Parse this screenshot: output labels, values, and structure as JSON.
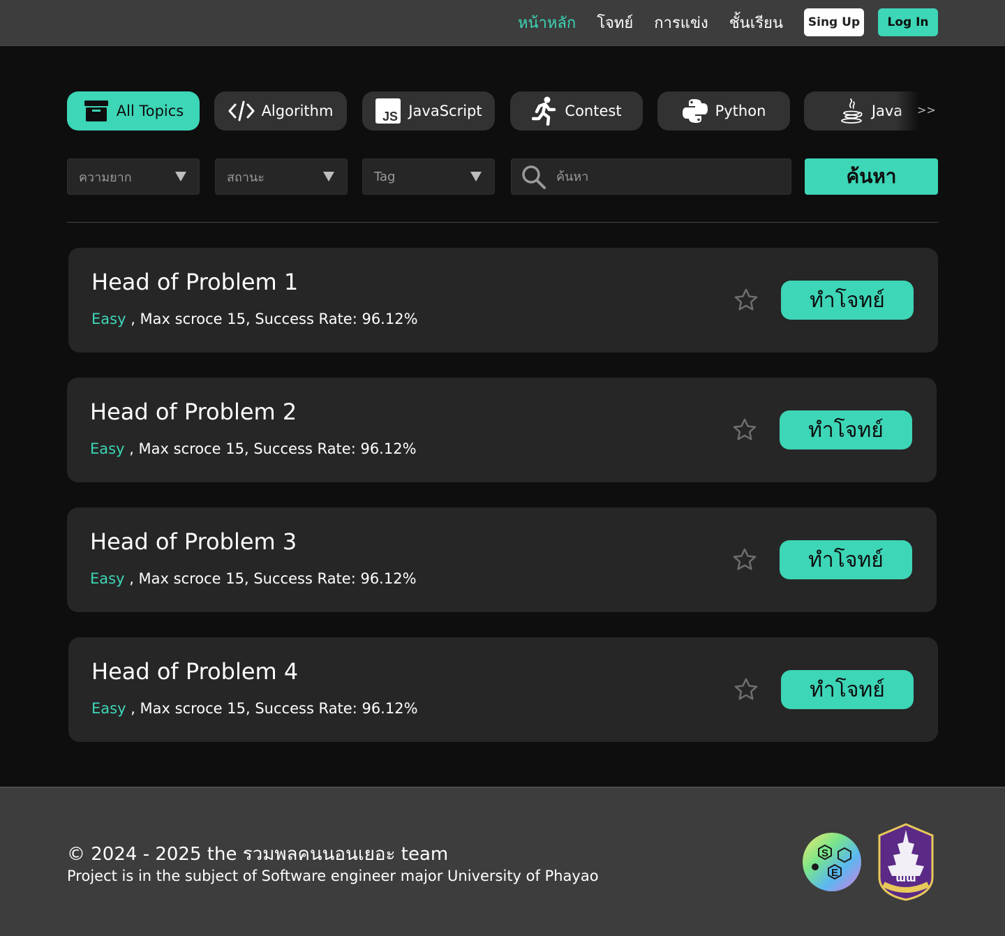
{
  "nav": {
    "links": [
      "หน้าหลัก",
      "โจทย์",
      "การแข่ง",
      "ชั้นเรียน"
    ],
    "signup_label": "Sing Up",
    "login_label": "Log In"
  },
  "topics": [
    {
      "label": "All Topics",
      "icon": "archive-icon"
    },
    {
      "label": "Algorithm",
      "icon": "code-icon"
    },
    {
      "label": "JavaScript",
      "icon": "js-icon"
    },
    {
      "label": "Contest",
      "icon": "running-icon"
    },
    {
      "label": "Python",
      "icon": "python-icon"
    },
    {
      "label": "Java",
      "icon": "java-icon"
    }
  ],
  "topics_more": ">>",
  "filters": {
    "difficulty": "ความยาก",
    "status": "สถานะ",
    "tag": "Tag",
    "search_placeholder": "ค้นหา",
    "search_button": "ค้นหา"
  },
  "problems": [
    {
      "title": "Head of Problem 1",
      "difficulty": "Easy",
      "meta": " , Max scroce 15, Success Rate: 96.12%",
      "button": "ทำโจทย์"
    },
    {
      "title": "Head of Problem 2",
      "difficulty": "Easy",
      "meta": " , Max scroce 15, Success Rate: 96.12%",
      "button": "ทำโจทย์"
    },
    {
      "title": "Head of Problem 3",
      "difficulty": "Easy",
      "meta": " , Max scroce 15, Success Rate: 96.12%",
      "button": "ทำโจทย์"
    },
    {
      "title": "Head of Problem 4",
      "difficulty": "Easy",
      "meta": " , Max scroce 15, Success Rate: 96.12%",
      "button": "ทำโจทย์"
    }
  ],
  "footer": {
    "copyright": "© 2024 - 2025 the รวมพลคนนอนเยอะ team",
    "note": "Project is in the subject of Software engineer major University of Phayao",
    "logo_se_letters": "SE",
    "logo_up_text": "มหาวิทยาลัยพะเยา"
  },
  "colors": {
    "accent": "#3dd6b7",
    "navbar": "#3d3d3d",
    "background": "#0e0e0e",
    "card": "#262626",
    "tab": "#323232"
  }
}
